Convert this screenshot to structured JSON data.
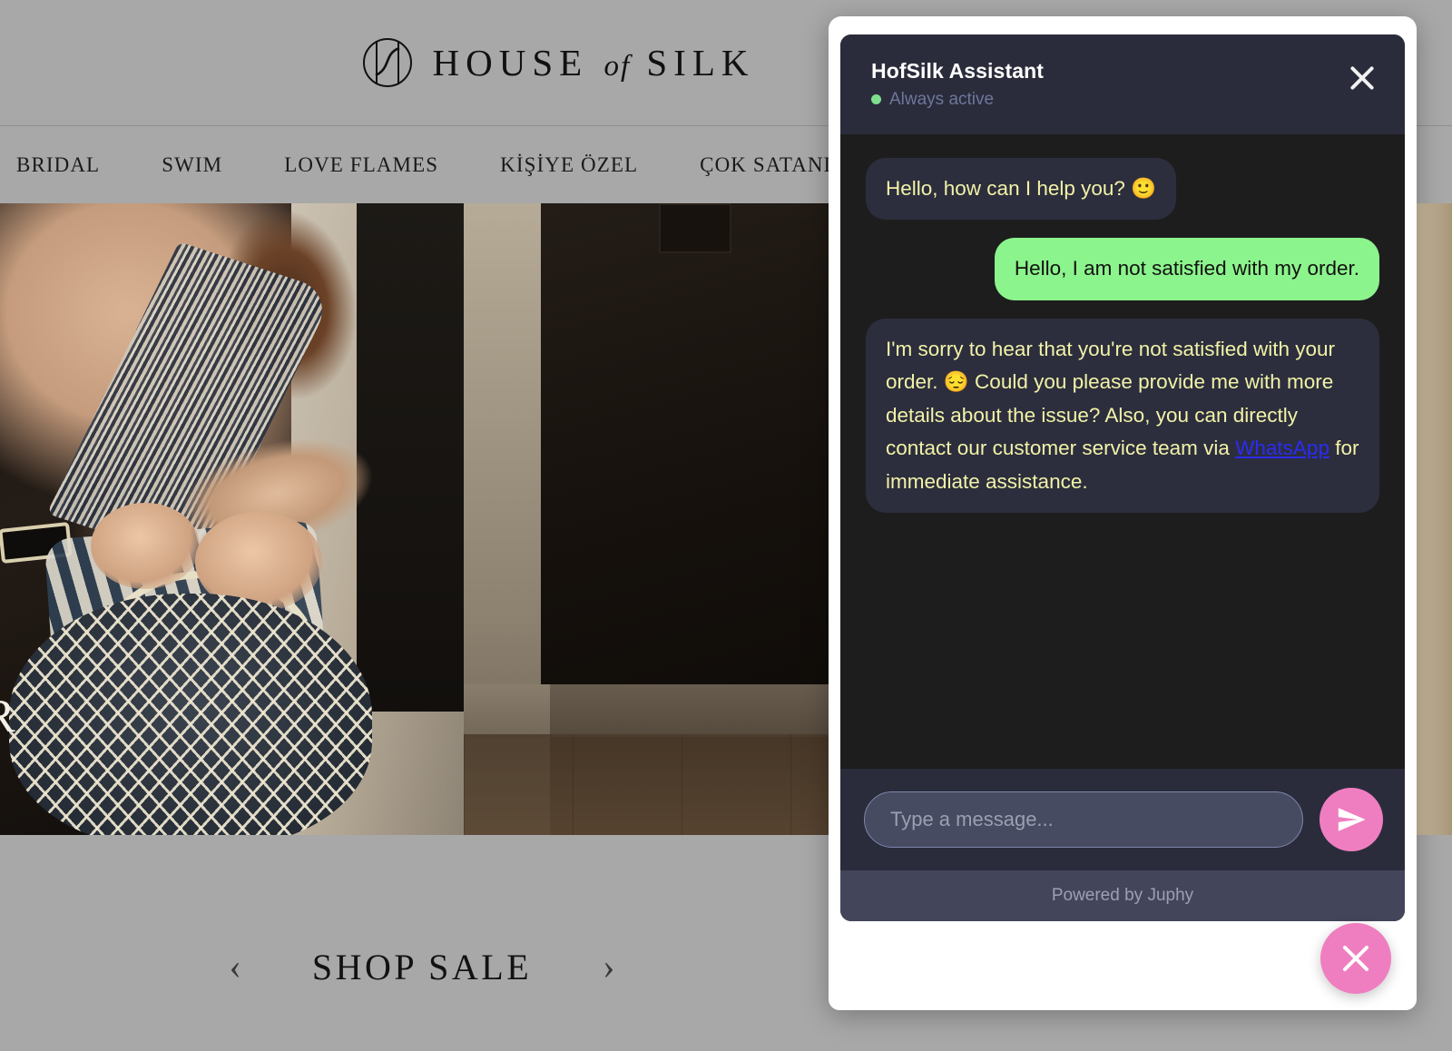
{
  "site": {
    "brand": {
      "name_part1": "HOUSE",
      "name_of": "of",
      "name_part2": "SILK",
      "logo_icon": "circle-monogram-icon"
    },
    "nav": [
      {
        "label": "BRIDAL"
      },
      {
        "label": "SWIM"
      },
      {
        "label": "LOVE FLAMES"
      },
      {
        "label": "KİŞİYE ÖZEL"
      },
      {
        "label": "ÇOK SATANLAR"
      }
    ],
    "hero": {
      "overlay_text": "R"
    },
    "shop_sale": {
      "prev_icon": "chevron-left-icon",
      "label": "SHOP SALE",
      "next_icon": "chevron-right-icon"
    }
  },
  "chat": {
    "header": {
      "title": "HofSilk Assistant",
      "status": "Always active",
      "status_color": "#7fdf8f",
      "close_icon": "close-icon"
    },
    "messages": [
      {
        "sender": "bot",
        "text": "Hello, how can I help you? 🙂"
      },
      {
        "sender": "user",
        "text": "Hello, I am not satisfied with my order."
      },
      {
        "sender": "bot",
        "text_before_link": "I'm sorry to hear that you're not satisfied with your order. 😔 Could you please provide me with more details about the issue? Also, you can directly contact our customer service team via ",
        "link_text": "WhatsApp",
        "text_after_link": " for immediate assistance."
      }
    ],
    "input": {
      "placeholder": "Type a message...",
      "value": ""
    },
    "send_button": {
      "icon": "send-paper-plane-icon",
      "color": "#ef7ec0"
    },
    "footer": {
      "text": "Powered by Juphy"
    },
    "fab": {
      "icon": "close-icon",
      "color": "#ef7ec0"
    }
  },
  "colors": {
    "page_background": "#a8a8a8",
    "chat_header": "#2a2c3b",
    "chat_body": "#1d1d1d",
    "bot_bubble": "#2c2e3d",
    "bot_text": "#f2f2a8",
    "user_bubble": "#8cf48c",
    "user_text": "#111111",
    "link": "#2b2bf5",
    "accent_pink": "#ef7ec0",
    "footer_bar": "#43465a"
  }
}
